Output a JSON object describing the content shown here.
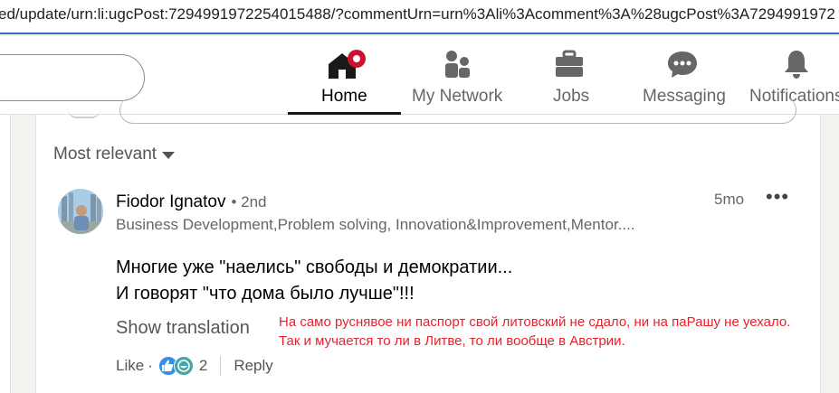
{
  "browser": {
    "url": "ed/update/urn:li:ugcPost:7294991972254015488/?commentUrn=urn%3Ali%3Acomment%3A%28ugcPost%3A7294991972"
  },
  "nav": {
    "home": "Home",
    "my_network": "My Network",
    "jobs": "Jobs",
    "messaging": "Messaging",
    "notifications": "Notifications"
  },
  "sort": {
    "label": "Most relevant"
  },
  "comment": {
    "author": "Fiodor Ignatov",
    "degree": "• 2nd",
    "headline": "Business Development,Problem solving, Innovation&Improvement,Mentor....",
    "time": "5mo",
    "more": "•••",
    "lines": [
      "Многие уже \"наелись\" свободы и демократии...",
      "И говорят \"что дома было лучше\"!!!"
    ],
    "show_translation": "Show translation",
    "like_label": "Like",
    "dot": "·",
    "reaction_count": "2",
    "reply_label": "Reply"
  },
  "overlay_note": {
    "lines": [
      "На само руснявое ни паспорт свой литовский не сдало, ни на паРашу не уехало.",
      "Так и мучается то ли в Литве, то ли вообще в Австрии."
    ],
    "color": "#e8222b"
  },
  "colors": {
    "notification_badge": "#cb112d",
    "url_underline": "#3a6cc6"
  }
}
